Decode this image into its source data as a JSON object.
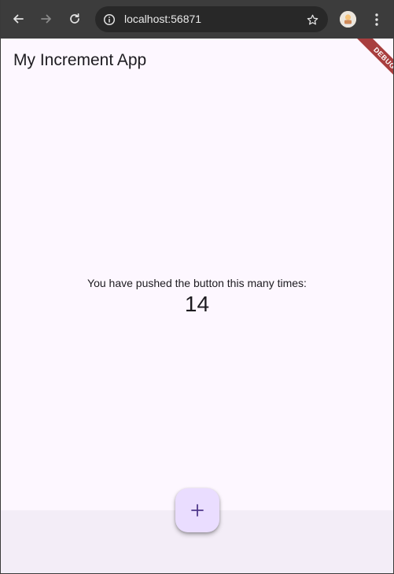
{
  "browser": {
    "url": "localhost:56871",
    "icons": {
      "back": "arrow-left-icon",
      "forward": "arrow-right-icon",
      "reload": "reload-icon",
      "info": "info-icon",
      "bookmark": "star-icon",
      "profile": "profile-avatar",
      "menu": "kebab-menu-icon"
    }
  },
  "app": {
    "title": "My Increment App",
    "debug_banner": "DEBUG",
    "counter_label": "You have pushed the button this many times:",
    "counter_value": "14",
    "fab_icon": "add-icon"
  },
  "colors": {
    "toolbar": "#3c3c3c",
    "app_background": "#fdf7ff",
    "bottom_bar": "#f3edf7",
    "fab_background": "#eaddff",
    "fab_icon": "#4f378b",
    "debug_banner": "#a83e3e"
  }
}
